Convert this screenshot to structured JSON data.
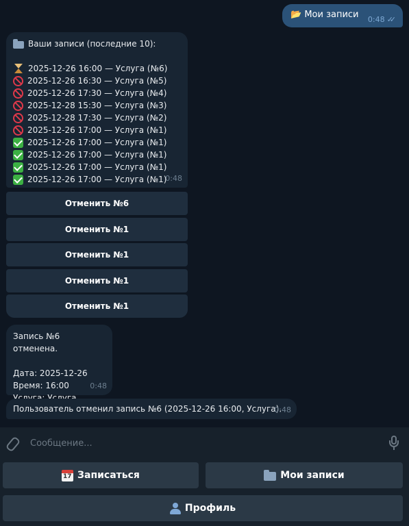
{
  "outgoing": {
    "text": "📂 Мои записи",
    "time": "0:48"
  },
  "records_message": {
    "header": "Ваши записи (последние 10):",
    "items": [
      {
        "status": "pending",
        "text": "2025-12-26 16:00 — Услуга (№6)"
      },
      {
        "status": "cancelled",
        "text": "2025-12-26 16:30 — Услуга (№5)"
      },
      {
        "status": "cancelled",
        "text": "2025-12-26 17:30 — Услуга (№4)"
      },
      {
        "status": "cancelled",
        "text": "2025-12-28 15:30 — Услуга (№3)"
      },
      {
        "status": "cancelled",
        "text": "2025-12-28 17:30 — Услуга (№2)"
      },
      {
        "status": "cancelled",
        "text": "2025-12-26 17:00 — Услуга (№1)"
      },
      {
        "status": "confirmed",
        "text": "2025-12-26 17:00 — Услуга (№1)"
      },
      {
        "status": "confirmed",
        "text": "2025-12-26 17:00 — Услуга (№1)"
      },
      {
        "status": "confirmed",
        "text": "2025-12-26 17:00 — Услуга (№1)"
      },
      {
        "status": "confirmed",
        "text": "2025-12-26 17:00 — Услуга (№1)"
      }
    ],
    "time": "0:48"
  },
  "inline_buttons": [
    "Отменить №6",
    "Отменить №1",
    "Отменить №1",
    "Отменить №1",
    "Отменить №1"
  ],
  "cancel_message": {
    "line1": "Запись №6 отменена.",
    "date": "Дата: 2025-12-26",
    "time_line": "Время: 16:00",
    "service": "Услуга: Услуга",
    "time": "0:48"
  },
  "notify_message": {
    "text": "Пользователь отменил запись №6 (2025-12-26 16:00, Услуга).",
    "time": "0:48"
  },
  "composer": {
    "placeholder": "Сообщение..."
  },
  "keyboard": {
    "book": "Записаться",
    "my_records": "Мои записи",
    "profile": "Профиль"
  },
  "colors": {
    "background": "#0e1621",
    "incoming_bubble": "#182533",
    "outgoing_bubble": "#2b5278",
    "panel": "#17212b"
  }
}
